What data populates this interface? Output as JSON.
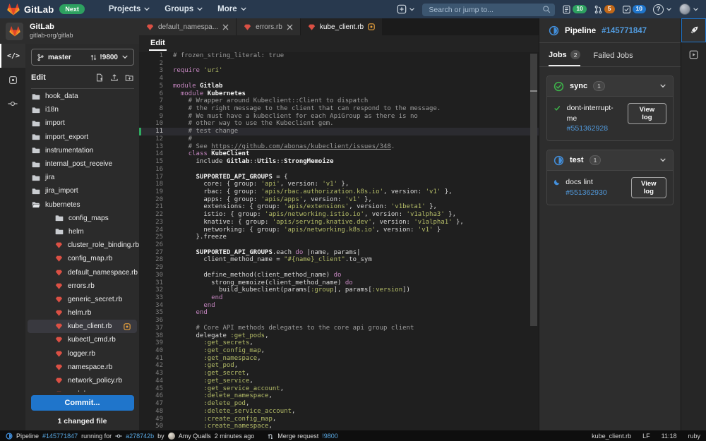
{
  "colors": {
    "accent_blue": "#1f75cb",
    "link_blue": "#519add",
    "success_green": "#3db54a",
    "running_blue": "#428fdc",
    "modified_orange": "#e9a13c",
    "gem_red": "#db5044",
    "next_green": "#2da160"
  },
  "topbar": {
    "logo": "GitLab",
    "next_badge": "Next",
    "menus": [
      "Projects",
      "Groups",
      "More"
    ],
    "search_placeholder": "Search or jump to...",
    "counters": [
      {
        "name": "issues",
        "count": "10",
        "color": "#2da160"
      },
      {
        "name": "merge-requests",
        "count": "5",
        "color": "#c26818"
      },
      {
        "name": "todos",
        "count": "10",
        "color": "#1f75cb"
      }
    ]
  },
  "sidebar": {
    "project_title": "GitLab",
    "project_path": "gitlab-org/gitlab",
    "branch_name": "master",
    "merge_request_ref": "!9800",
    "panel_label": "Edit",
    "tree": [
      {
        "label": "hook_data",
        "type": "folder",
        "indent": 0
      },
      {
        "label": "i18n",
        "type": "folder",
        "indent": 0
      },
      {
        "label": "import",
        "type": "folder",
        "indent": 0
      },
      {
        "label": "import_export",
        "type": "folder",
        "indent": 0
      },
      {
        "label": "instrumentation",
        "type": "folder",
        "indent": 0
      },
      {
        "label": "internal_post_receive",
        "type": "folder",
        "indent": 0
      },
      {
        "label": "jira",
        "type": "folder",
        "indent": 0
      },
      {
        "label": "jira_import",
        "type": "folder",
        "indent": 0
      },
      {
        "label": "kubernetes",
        "type": "folder-open",
        "indent": 0
      },
      {
        "label": "config_maps",
        "type": "folder",
        "indent": 1
      },
      {
        "label": "helm",
        "type": "folder",
        "indent": 1
      },
      {
        "label": "cluster_role_binding.rb",
        "type": "ruby",
        "indent": 1
      },
      {
        "label": "config_map.rb",
        "type": "ruby",
        "indent": 1
      },
      {
        "label": "default_namespace.rb",
        "type": "ruby",
        "indent": 1
      },
      {
        "label": "errors.rb",
        "type": "ruby",
        "indent": 1
      },
      {
        "label": "generic_secret.rb",
        "type": "ruby",
        "indent": 1
      },
      {
        "label": "helm.rb",
        "type": "ruby",
        "indent": 1
      },
      {
        "label": "kube_client.rb",
        "type": "ruby",
        "indent": 1,
        "selected": true,
        "modified": true
      },
      {
        "label": "kubectl_cmd.rb",
        "type": "ruby",
        "indent": 1
      },
      {
        "label": "logger.rb",
        "type": "ruby",
        "indent": 1
      },
      {
        "label": "namespace.rb",
        "type": "ruby",
        "indent": 1
      },
      {
        "label": "network_policy.rb",
        "type": "ruby",
        "indent": 1
      },
      {
        "label": "pod.rb",
        "type": "ruby",
        "indent": 1
      }
    ],
    "commit_button": "Commit...",
    "changed_files": "1 changed file"
  },
  "editor": {
    "tabs": [
      {
        "label": "default_namespa...",
        "close": true
      },
      {
        "label": "errors.rb",
        "close": true
      },
      {
        "label": "kube_client.rb",
        "modified": true,
        "active": true
      }
    ],
    "mode_tab": "Edit",
    "active_line": 11,
    "code": [
      {
        "t": [
          [
            "c",
            "# frozen_string_literal: true"
          ]
        ]
      },
      {
        "t": []
      },
      {
        "t": [
          [
            "k",
            "require"
          ],
          [
            "p",
            " "
          ],
          [
            "s",
            "'uri'"
          ]
        ]
      },
      {
        "t": []
      },
      {
        "t": [
          [
            "k",
            "module"
          ],
          [
            "p",
            " "
          ],
          [
            "b",
            "Gitlab"
          ]
        ]
      },
      {
        "t": [
          [
            "p",
            "  "
          ],
          [
            "k",
            "module"
          ],
          [
            "p",
            " "
          ],
          [
            "b",
            "Kubernetes"
          ]
        ]
      },
      {
        "t": [
          [
            "c",
            "    # Wrapper around Kubeclient::Client to dispatch"
          ]
        ]
      },
      {
        "t": [
          [
            "c",
            "    # the right message to the client that can respond to the message."
          ]
        ]
      },
      {
        "t": [
          [
            "c",
            "    # We must have a kubeclient for each ApiGroup as there is no"
          ]
        ]
      },
      {
        "t": [
          [
            "c",
            "    # other way to use the Kubeclient gem."
          ]
        ]
      },
      {
        "t": [
          [
            "c",
            "    # test change"
          ]
        ]
      },
      {
        "t": [
          [
            "c",
            "    #"
          ]
        ]
      },
      {
        "t": [
          [
            "c",
            "    # See "
          ],
          [
            "u",
            "https://github.com/abonas/kubeclient/issues/348"
          ],
          [
            "c",
            "."
          ]
        ]
      },
      {
        "t": [
          [
            "p",
            "    "
          ],
          [
            "k",
            "class"
          ],
          [
            "p",
            " "
          ],
          [
            "b",
            "KubeClient"
          ]
        ]
      },
      {
        "t": [
          [
            "p",
            "      include "
          ],
          [
            "b",
            "Gitlab"
          ],
          [
            "p",
            "::"
          ],
          [
            "b",
            "Utils"
          ],
          [
            "p",
            "::"
          ],
          [
            "b",
            "StrongMemoize"
          ]
        ]
      },
      {
        "t": []
      },
      {
        "t": [
          [
            "p",
            "      "
          ],
          [
            "b",
            "SUPPORTED_API_GROUPS"
          ],
          [
            "p",
            " = {"
          ]
        ]
      },
      {
        "t": [
          [
            "p",
            "        core: { group: "
          ],
          [
            "s",
            "'api'"
          ],
          [
            "p",
            ", version: "
          ],
          [
            "s",
            "'v1'"
          ],
          [
            "p",
            " },"
          ]
        ]
      },
      {
        "t": [
          [
            "p",
            "        rbac: { group: "
          ],
          [
            "s",
            "'apis/rbac.authorization.k8s.io'"
          ],
          [
            "p",
            ", version: "
          ],
          [
            "s",
            "'v1'"
          ],
          [
            "p",
            " },"
          ]
        ]
      },
      {
        "t": [
          [
            "p",
            "        apps: { group: "
          ],
          [
            "s",
            "'apis/apps'"
          ],
          [
            "p",
            ", version: "
          ],
          [
            "s",
            "'v1'"
          ],
          [
            "p",
            " },"
          ]
        ]
      },
      {
        "t": [
          [
            "p",
            "        extensions: { group: "
          ],
          [
            "s",
            "'apis/extensions'"
          ],
          [
            "p",
            ", version: "
          ],
          [
            "s",
            "'v1beta1'"
          ],
          [
            "p",
            " },"
          ]
        ]
      },
      {
        "t": [
          [
            "p",
            "        istio: { group: "
          ],
          [
            "s",
            "'apis/networking.istio.io'"
          ],
          [
            "p",
            ", version: "
          ],
          [
            "s",
            "'v1alpha3'"
          ],
          [
            "p",
            " },"
          ]
        ]
      },
      {
        "t": [
          [
            "p",
            "        knative: { group: "
          ],
          [
            "s",
            "'apis/serving.knative.dev'"
          ],
          [
            "p",
            ", version: "
          ],
          [
            "s",
            "'v1alpha1'"
          ],
          [
            "p",
            " },"
          ]
        ]
      },
      {
        "t": [
          [
            "p",
            "        networking: { group: "
          ],
          [
            "s",
            "'apis/networking.k8s.io'"
          ],
          [
            "p",
            ", version: "
          ],
          [
            "s",
            "'v1'"
          ],
          [
            "p",
            " }"
          ]
        ]
      },
      {
        "t": [
          [
            "p",
            "      }.freeze"
          ]
        ]
      },
      {
        "t": []
      },
      {
        "t": [
          [
            "p",
            "      "
          ],
          [
            "b",
            "SUPPORTED_API_GROUPS"
          ],
          [
            "p",
            ".each "
          ],
          [
            "k",
            "do"
          ],
          [
            "p",
            " |name, params|"
          ]
        ]
      },
      {
        "t": [
          [
            "p",
            "        client_method_name = "
          ],
          [
            "s",
            "\"#{name}_client\""
          ],
          [
            "p",
            ".to_sym"
          ]
        ]
      },
      {
        "t": []
      },
      {
        "t": [
          [
            "p",
            "        define_method(client_method_name) "
          ],
          [
            "k",
            "do"
          ]
        ]
      },
      {
        "t": [
          [
            "p",
            "          strong_memoize(client_method_name) "
          ],
          [
            "k",
            "do"
          ]
        ]
      },
      {
        "t": [
          [
            "p",
            "            build_kubeclient(params["
          ],
          [
            "s",
            ":group"
          ],
          [
            "p",
            "], params["
          ],
          [
            "s",
            ":version"
          ],
          [
            "p",
            "])"
          ]
        ]
      },
      {
        "t": [
          [
            "p",
            "          "
          ],
          [
            "k",
            "end"
          ]
        ]
      },
      {
        "t": [
          [
            "p",
            "        "
          ],
          [
            "k",
            "end"
          ]
        ]
      },
      {
        "t": [
          [
            "p",
            "      "
          ],
          [
            "k",
            "end"
          ]
        ]
      },
      {
        "t": []
      },
      {
        "t": [
          [
            "c",
            "      # Core API methods delegates to the core api group client"
          ]
        ]
      },
      {
        "t": [
          [
            "p",
            "      delegate "
          ],
          [
            "s",
            ":get_pods"
          ],
          [
            "p",
            ","
          ]
        ]
      },
      {
        "t": [
          [
            "p",
            "        "
          ],
          [
            "s",
            ":get_secrets"
          ],
          [
            "p",
            ","
          ]
        ]
      },
      {
        "t": [
          [
            "p",
            "        "
          ],
          [
            "s",
            ":get_config_map"
          ],
          [
            "p",
            ","
          ]
        ]
      },
      {
        "t": [
          [
            "p",
            "        "
          ],
          [
            "s",
            ":get_namespace"
          ],
          [
            "p",
            ","
          ]
        ]
      },
      {
        "t": [
          [
            "p",
            "        "
          ],
          [
            "s",
            ":get_pod"
          ],
          [
            "p",
            ","
          ]
        ]
      },
      {
        "t": [
          [
            "p",
            "        "
          ],
          [
            "s",
            ":get_secret"
          ],
          [
            "p",
            ","
          ]
        ]
      },
      {
        "t": [
          [
            "p",
            "        "
          ],
          [
            "s",
            ":get_service"
          ],
          [
            "p",
            ","
          ]
        ]
      },
      {
        "t": [
          [
            "p",
            "        "
          ],
          [
            "s",
            ":get_service_account"
          ],
          [
            "p",
            ","
          ]
        ]
      },
      {
        "t": [
          [
            "p",
            "        "
          ],
          [
            "s",
            ":delete_namespace"
          ],
          [
            "p",
            ","
          ]
        ]
      },
      {
        "t": [
          [
            "p",
            "        "
          ],
          [
            "s",
            ":delete_pod"
          ],
          [
            "p",
            ","
          ]
        ]
      },
      {
        "t": [
          [
            "p",
            "        "
          ],
          [
            "s",
            ":delete_service_account"
          ],
          [
            "p",
            ","
          ]
        ]
      },
      {
        "t": [
          [
            "p",
            "        "
          ],
          [
            "s",
            ":create_config_map"
          ],
          [
            "p",
            ","
          ]
        ]
      },
      {
        "t": [
          [
            "p",
            "        "
          ],
          [
            "s",
            ":create_namespace"
          ],
          [
            "p",
            ","
          ]
        ]
      }
    ]
  },
  "pipeline": {
    "title": "Pipeline",
    "id": "#145771847",
    "status": "running",
    "tabs": [
      {
        "label": "Jobs",
        "badge": "2",
        "active": true
      },
      {
        "label": "Failed Jobs"
      }
    ],
    "stages": [
      {
        "name": "sync",
        "count": "1",
        "status": "success",
        "jobs": [
          {
            "name": "dont-interrupt-me",
            "id": "#551362928",
            "status": "success",
            "action": "View log",
            "two_line": true
          }
        ]
      },
      {
        "name": "test",
        "count": "1",
        "status": "running",
        "jobs": [
          {
            "name": "docs lint",
            "id": "#551362930",
            "status": "running",
            "action": "View log"
          }
        ]
      }
    ]
  },
  "statusbar": {
    "pipeline_label": "Pipeline",
    "pipeline_id": "#145771847",
    "running_text": "running for",
    "commit_sha": "a278742b",
    "by_text": "by",
    "author": "Amy Qualls",
    "time": "2 minutes ago",
    "mr_label": "Merge request",
    "mr_id": "!9800",
    "file_name": "kube_client.rb",
    "line_ending": "LF",
    "cursor": "11:18",
    "language": "ruby"
  }
}
